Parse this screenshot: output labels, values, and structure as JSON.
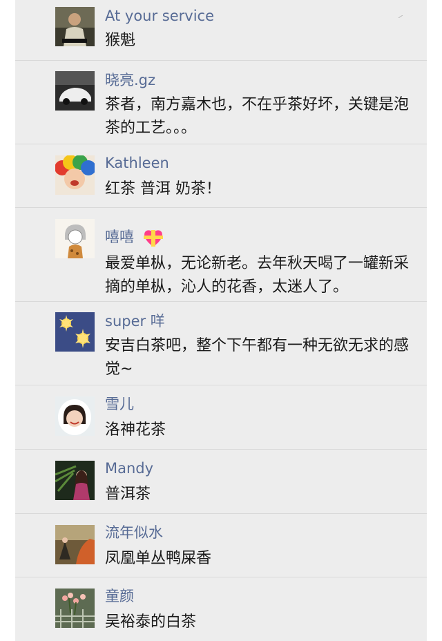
{
  "comments": [
    {
      "name": "At your service",
      "text": "猴魁",
      "avatar": "man-portrait-avatar"
    },
    {
      "name": "晓亮.gz",
      "text": "茶者，南方嘉木也，不在乎茶好坏，关键是泡茶的工艺。。。",
      "avatar": "white-car-avatar"
    },
    {
      "name": "Kathleen",
      "text": "红茶 普洱 奶茶！",
      "avatar": "rainbow-wig-avatar"
    },
    {
      "name": "嘻嘻",
      "text": "最爱单枞，无论新老。去年秋天喝了一罐新采摘的单枞，沁人的花香，太迷人了。",
      "avatar": "cartoon-girl-avatar",
      "name_emoji": "gift-heart-emoji"
    },
    {
      "name": "super 咩",
      "text": "安吉白茶吧，整个下午都有一种无欲无求的感觉~",
      "avatar": "stars-night-avatar"
    },
    {
      "name": "雪儿",
      "text": "洛神花茶",
      "avatar": "girl-white-hood-avatar"
    },
    {
      "name": "Mandy",
      "text": "普洱茶",
      "avatar": "woman-palm-avatar"
    },
    {
      "name": "流年似水",
      "text": "凤凰单丛鸭屎香",
      "avatar": "painting-avatar"
    },
    {
      "name": "童颜",
      "text": "吴裕泰的白茶",
      "avatar": "flowers-fence-avatar"
    }
  ]
}
